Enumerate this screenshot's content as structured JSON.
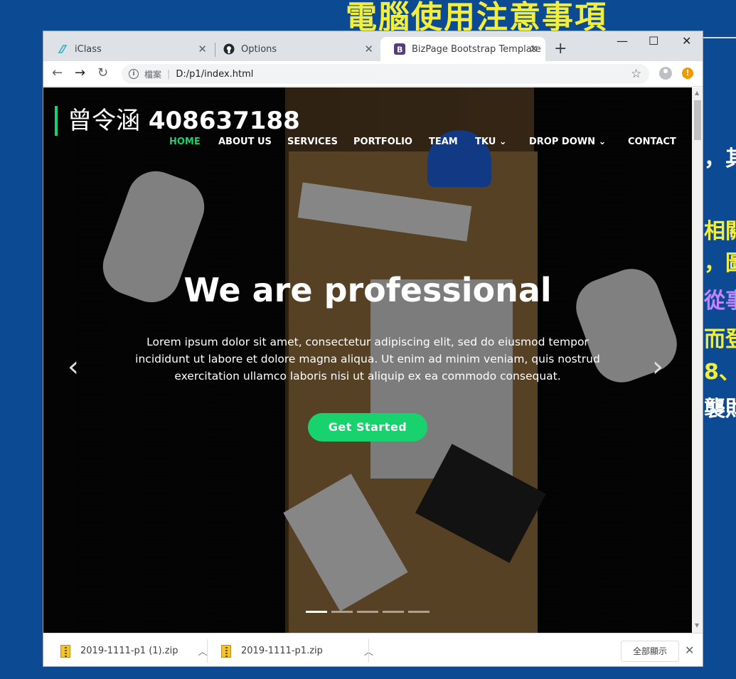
{
  "slide": {
    "title": "電腦使用注意事項",
    "fragments": [
      {
        "text": "，其",
        "color": "#ffffff"
      },
      {
        "text": "相關",
        "color": "#f2ee3a"
      },
      {
        "text": "，圖",
        "color": "#f2ee3a"
      },
      {
        "text": "從事",
        "color": "#c583ff"
      },
      {
        "text": "而登",
        "color": "#f2ee3a"
      },
      {
        "text": "8、",
        "color": "#f2ee3a"
      },
      {
        "text": "襲財",
        "color": "#ffffff"
      }
    ]
  },
  "browser": {
    "tabs": [
      {
        "label": "iClass",
        "icon": "iclass-icon",
        "active": false
      },
      {
        "label": "Options",
        "icon": "github-icon",
        "active": false
      },
      {
        "label": "BizPage Bootstrap Template",
        "icon": "bootstrap-icon",
        "active": true
      }
    ],
    "new_tab": "+",
    "window_controls": {
      "minimize": "—",
      "maximize": "☐",
      "close": "✕"
    },
    "address": {
      "security_label": "檔案",
      "url": "D:/p1/index.html"
    }
  },
  "page": {
    "brand": "曾令涵 408637188",
    "brand_name": "曾令涵",
    "brand_id": "408637188",
    "nav": [
      {
        "label": "HOME",
        "active": true
      },
      {
        "label": "ABOUT US"
      },
      {
        "label": "SERVICES"
      },
      {
        "label": "PORTFOLIO"
      },
      {
        "label": "TEAM"
      },
      {
        "label": "TKU ⌄"
      },
      {
        "label": "DROP DOWN ⌄"
      },
      {
        "label": "CONTACT"
      }
    ],
    "hero_title": "We are professional",
    "hero_text": "Lorem ipsum dolor sit amet, consectetur adipiscing elit, sed do eiusmod tempor incididunt ut labore et dolore magna aliqua. Ut enim ad minim veniam, quis nostrud exercitation ullamco laboris nisi ut aliquip ex ea commodo consequat.",
    "hero_button": "Get Started",
    "prev_arrow": "‹",
    "next_arrow": "›",
    "slide_count": 5,
    "active_slide": 1
  },
  "downloads": {
    "items": [
      {
        "filename": "2019-1111-p1 (1).zip"
      },
      {
        "filename": "2019-1111-p1.zip"
      }
    ],
    "show_all": "全部顯示",
    "close": "✕"
  },
  "colors": {
    "accent": "#18d26e",
    "slide_bg": "#0c4a94",
    "slide_title": "#f2ee3a"
  }
}
